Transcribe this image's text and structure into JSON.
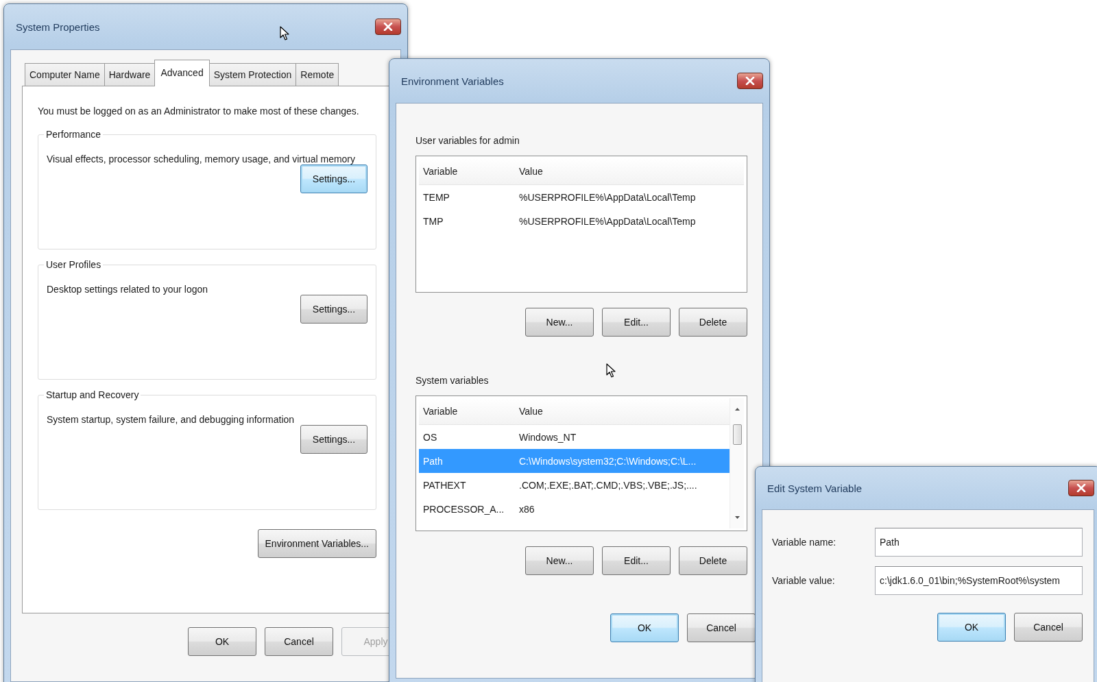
{
  "system_properties": {
    "title": "System Properties",
    "tabs": [
      {
        "label": "Computer Name",
        "selected": false
      },
      {
        "label": "Hardware",
        "selected": false
      },
      {
        "label": "Advanced",
        "selected": true
      },
      {
        "label": "System Protection",
        "selected": false
      },
      {
        "label": "Remote",
        "selected": false
      }
    ],
    "notice": "You must be logged on as an Administrator to make most of these changes.",
    "groups": [
      {
        "title": "Performance",
        "description": "Visual effects, processor scheduling, memory usage, and virtual memory",
        "button": {
          "label": "Settings...",
          "focused": true
        }
      },
      {
        "title": "User Profiles",
        "description": "Desktop settings related to your logon",
        "button": {
          "label": "Settings...",
          "focused": false
        }
      },
      {
        "title": "Startup and Recovery",
        "description": "System startup, system failure, and debugging information",
        "button": {
          "label": "Settings...",
          "focused": false
        }
      }
    ],
    "environment_button": {
      "label": "Environment Variables...",
      "focused": false
    },
    "buttons": [
      {
        "label": "OK",
        "focused": false,
        "disabled": false
      },
      {
        "label": "Cancel",
        "focused": false,
        "disabled": false
      },
      {
        "label": "Apply",
        "focused": false,
        "disabled": true
      }
    ]
  },
  "environment_variables": {
    "title": "Environment Variables",
    "user_variables": {
      "title": "User variables for admin",
      "columns": [
        "Variable",
        "Value"
      ],
      "rows": [
        {
          "variable": "TEMP",
          "value": "%USERPROFILE%\\AppData\\Local\\Temp",
          "selected": false
        },
        {
          "variable": "TMP",
          "value": "%USERPROFILE%\\AppData\\Local\\Temp",
          "selected": false
        }
      ],
      "buttons": [
        {
          "label": "New...",
          "focused": false
        },
        {
          "label": "Edit...",
          "focused": false
        },
        {
          "label": "Delete",
          "focused": false
        }
      ]
    },
    "system_variables": {
      "title": "System variables",
      "columns": [
        "Variable",
        "Value"
      ],
      "rows": [
        {
          "variable": "OS",
          "value": "Windows_NT",
          "selected": false
        },
        {
          "variable": "Path",
          "value": "C:\\Windows\\system32;C:\\Windows;C:\\L...",
          "selected": true
        },
        {
          "variable": "PATHEXT",
          "value": ".COM;.EXE;.BAT;.CMD;.VBS;.VBE;.JS;....",
          "selected": false
        },
        {
          "variable": "PROCESSOR_A...",
          "value": "x86",
          "selected": false
        }
      ],
      "buttons": [
        {
          "label": "New...",
          "focused": false
        },
        {
          "label": "Edit...",
          "focused": false
        },
        {
          "label": "Delete",
          "focused": false
        }
      ]
    },
    "buttons": [
      {
        "label": "OK",
        "focused": true
      },
      {
        "label": "Cancel",
        "focused": false
      }
    ]
  },
  "edit_system_variable": {
    "title": "Edit System Variable",
    "fields": [
      {
        "label": "Variable name:",
        "value": "Path"
      },
      {
        "label": "Variable value:",
        "value": "c:\\jdk1.6.0_01\\bin;%SystemRoot%\\system"
      }
    ],
    "buttons": [
      {
        "label": "OK",
        "focused": true
      },
      {
        "label": "Cancel",
        "focused": false
      }
    ]
  }
}
